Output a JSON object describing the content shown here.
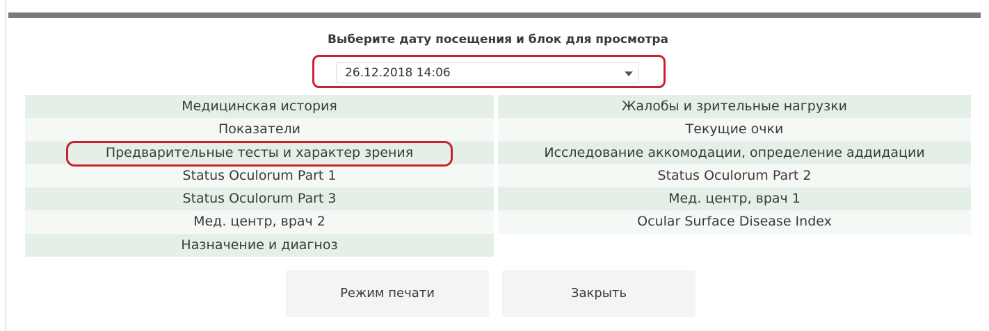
{
  "dialog": {
    "title": "Выберите дату посещения и блок для просмотра",
    "visit_date": {
      "selected": "26.12.2018 14:06"
    }
  },
  "blocks": {
    "left": [
      "Медицинская история",
      "Показатели",
      "Предварительные тесты и характер зрения",
      "Status Oculorum Part 1",
      "Status Oculorum Part 3",
      "Мед. центр, врач 2",
      "Назначение и диагноз"
    ],
    "right": [
      "Жалобы и зрительные нагрузки",
      "Текущие очки",
      "Исследование аккомодации, определение аддидации",
      "Status Oculorum Part 2",
      "Мед. центр, врач 1",
      "Ocular Surface Disease Index"
    ]
  },
  "buttons": {
    "print": "Режим печати",
    "close": "Закрыть"
  },
  "colors": {
    "row_odd": "#e4efe8",
    "row_even": "#f4f9f6",
    "highlight": "#c9222e",
    "top_bar": "#7a7a7a"
  }
}
